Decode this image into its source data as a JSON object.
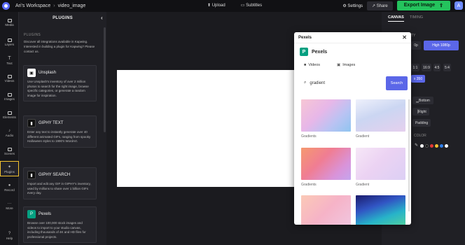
{
  "topbar": {
    "workspace": "Ari's Workspace",
    "separator": "›",
    "project": "video_image",
    "upload": "Upload",
    "subtitles": "Subtitles",
    "settings": "Settings",
    "share": "Share",
    "export": "Export Image",
    "avatar": "A"
  },
  "leftnav": [
    {
      "label": "Media"
    },
    {
      "label": "Layers"
    },
    {
      "label": "Text"
    },
    {
      "label": "Videos"
    },
    {
      "label": "Images"
    },
    {
      "label": "Elements"
    },
    {
      "label": "Audio"
    },
    {
      "label": "Scenes"
    },
    {
      "label": "Plugins"
    },
    {
      "label": "Record"
    },
    {
      "label": "More"
    },
    {
      "label": "Help"
    }
  ],
  "plugins": {
    "title": "PLUGINS",
    "section": "PLUGINS",
    "intro": "Discover all integrations available in Kapwing. Interested in building a plugin for Kapwing? Please contact us.",
    "cards": [
      {
        "title": "Unsplash",
        "desc": "Use Unsplash's inventory of over 2 million photos to search for the right image, browse specific categories, or generate a random image for inspiration."
      },
      {
        "title": "GIPHY TEXT",
        "desc": "Enter any text to instantly generate over 40 different animated GIFs, ranging from spooky Halloween styles to 1990's WordArt."
      },
      {
        "title": "GIPHY SEARCH",
        "desc": "Import and edit any GIF in GIPHY's inventory, used by millions to share over 1 billion GIFs every day."
      },
      {
        "title": "Pexels",
        "desc": "Browse over 100,000 stock images and videos to import to your studio canvas, including thousands of 4K and HD files for professional projects."
      }
    ]
  },
  "rightpanel": {
    "tab_canvas": "CANVAS",
    "tab_timing": "TIMING",
    "quality_label": "TY",
    "res_left": "0p",
    "res_right": "High 1080p",
    "ratios": [
      "1:1",
      "16:9",
      "4:5",
      "5:4"
    ],
    "size_chip": "x 350",
    "bottom": "Bottom",
    "right": "Right",
    "padding": "Padding",
    "color_label": "COLOR"
  },
  "modal": {
    "title": "Pexels",
    "brand": "Pexels",
    "tab_videos": "Videos",
    "tab_images": "Images",
    "search_value": "gradient",
    "search_button": "Search",
    "results": [
      {
        "label": "Gradients"
      },
      {
        "label": "Gradient"
      },
      {
        "label": "Gradients"
      },
      {
        "label": "Gradient"
      },
      {
        "label": ""
      },
      {
        "label": ""
      }
    ]
  },
  "colors": {
    "accent": "#5b67e8",
    "export_green": "#24c35d",
    "pexels_green": "#05a081",
    "active_nav": "#f2c230"
  }
}
